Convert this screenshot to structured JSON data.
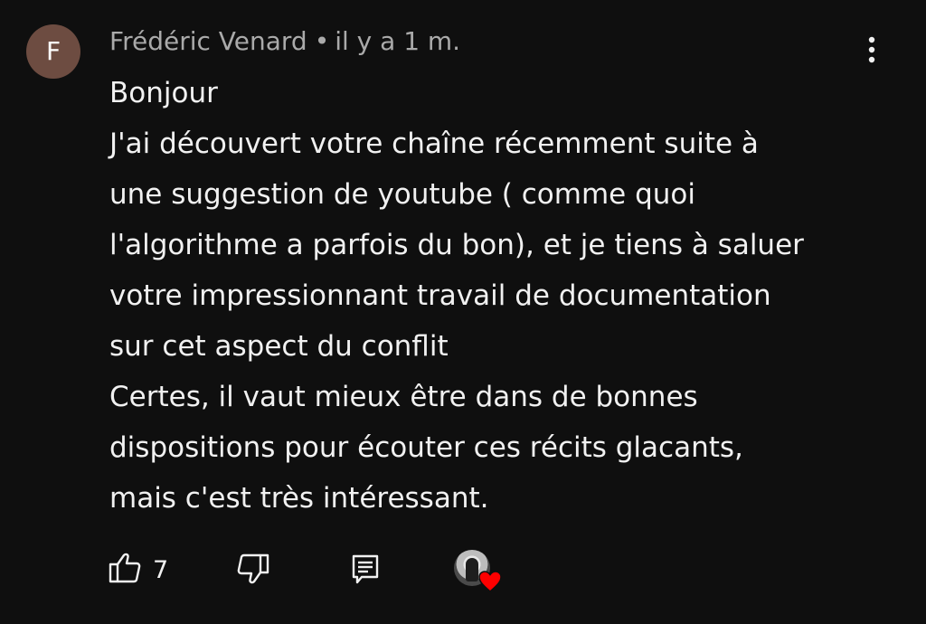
{
  "comment": {
    "avatar_letter": "F",
    "avatar_color": "#6d4c41",
    "author": "Frédéric Venard",
    "separator": "•",
    "timestamp": "il y a 1 m.",
    "menu_icon": "more-vert-icon",
    "body_lines": [
      "Bonjour",
      "J'ai découvert votre chaîne récemment suite à",
      "une suggestion de youtube ( comme quoi",
      "l'algorithme a parfois du bon), et je tiens à saluer",
      "votre impressionnant travail de documentation",
      "sur cet aspect du conflit",
      "Certes, il vaut mieux être dans de bonnes",
      "dispositions pour écouter ces récits glacants,",
      "mais c'est très intéressant."
    ]
  },
  "actions": {
    "like_icon": "thumbs-up-icon",
    "like_count": "7",
    "dislike_icon": "thumbs-down-icon",
    "reply_icon": "reply-icon",
    "creator_heart_icon": "creator-heart-icon",
    "heart_color": "#ff0000"
  },
  "colors": {
    "background": "#0f0f0f",
    "text_primary": "#f1f1f1",
    "text_secondary": "#aaaaaa"
  }
}
